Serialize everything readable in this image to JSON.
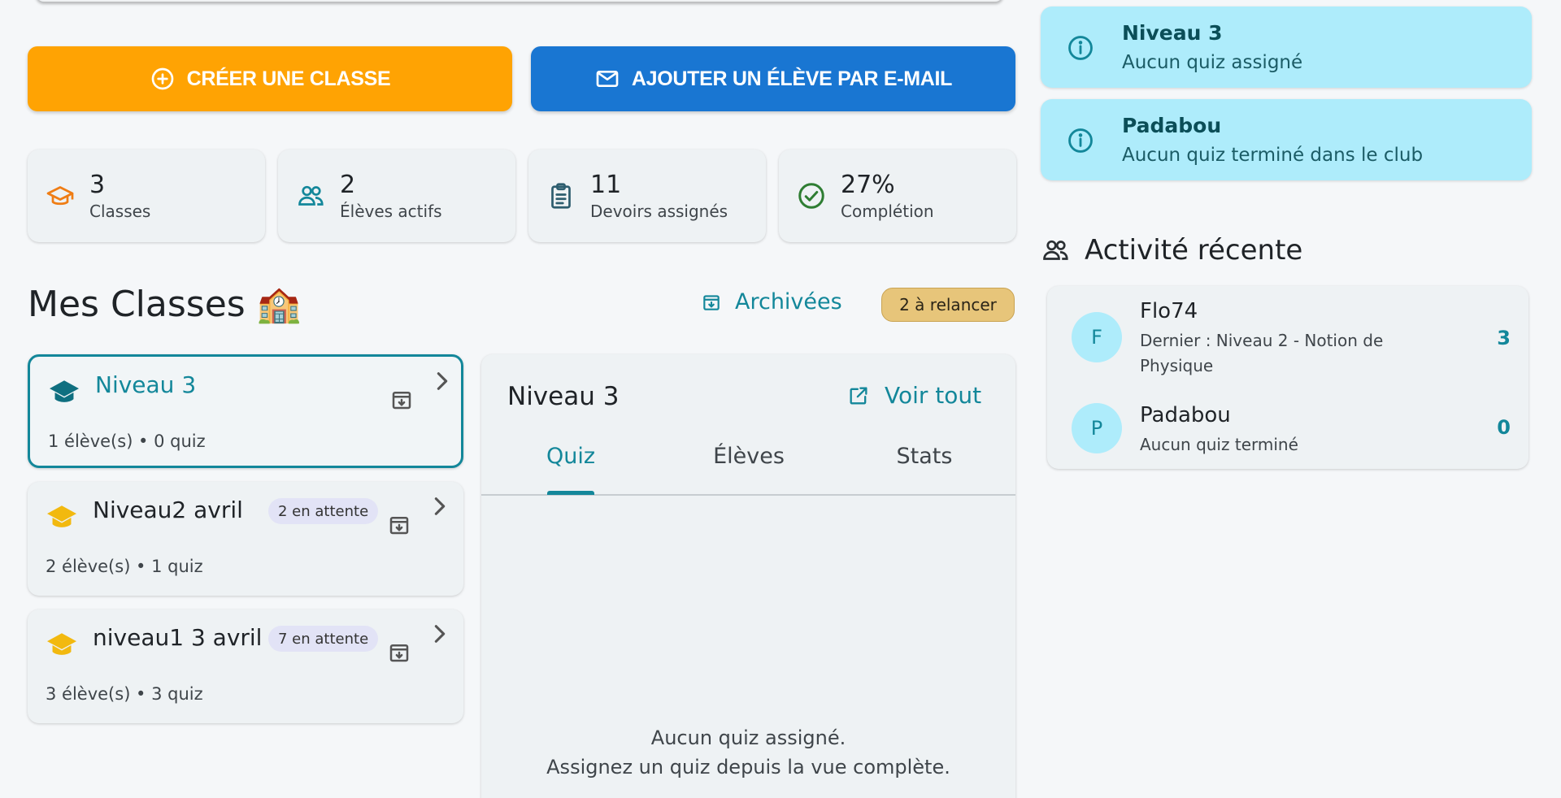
{
  "actions": {
    "create_class": "CRÉER UNE CLASSE",
    "add_student": "AJOUTER UN ÉLÈVE PAR E-MAIL"
  },
  "stats": [
    {
      "value": "3",
      "label": "Classes",
      "icon": "graduation-cap-icon",
      "color": "#ef7d14"
    },
    {
      "value": "2",
      "label": "Élèves actifs",
      "icon": "users-icon",
      "color": "#13879a"
    },
    {
      "value": "11",
      "label": "Devoirs assignés",
      "icon": "clipboard-icon",
      "color": "#2d5d6e"
    },
    {
      "value": "27%",
      "label": "Complétion",
      "icon": "check-circle-icon",
      "color": "#2e7d32"
    }
  ],
  "classes_section": {
    "title": "Mes Classes 🏫",
    "archived_label": "Archivées",
    "relance_badge": "2 à relancer"
  },
  "classes": [
    {
      "name": "Niveau 3",
      "pending": "",
      "meta": "1 élève(s) • 0 quiz",
      "active": true
    },
    {
      "name": "Niveau2 avril",
      "pending": "2 en attente",
      "meta": "2 élève(s) • 1 quiz",
      "active": false
    },
    {
      "name": "niveau1 3 avril",
      "pending": "7 en attente",
      "meta": "3 élève(s) • 3 quiz",
      "active": false
    }
  ],
  "detail": {
    "title": "Niveau 3",
    "see_all": "Voir tout",
    "tabs": [
      "Quiz",
      "Élèves",
      "Stats"
    ],
    "active_tab": "Quiz",
    "empty_line1": "Aucun quiz assigné.",
    "empty_line2": "Assignez un quiz depuis la vue complète."
  },
  "notices": [
    {
      "title": "Niveau 3",
      "subtitle": "Aucun quiz assigné"
    },
    {
      "title": "Padabou",
      "subtitle": "Aucun quiz terminé dans le club"
    }
  ],
  "activity": {
    "title": "Activité récente",
    "items": [
      {
        "initial": "F",
        "name": "Flo74",
        "desc": "Dernier : Niveau 2 - Notion de Physique",
        "count": "3"
      },
      {
        "initial": "P",
        "name": "Padabou",
        "desc": "Aucun quiz terminé",
        "count": "0"
      }
    ]
  },
  "colors": {
    "accent": "#13879a",
    "orange": "#ffa303",
    "blue": "#1976d2",
    "info_bg": "#aeecfb",
    "cap_yellow": "#f2b90f"
  }
}
